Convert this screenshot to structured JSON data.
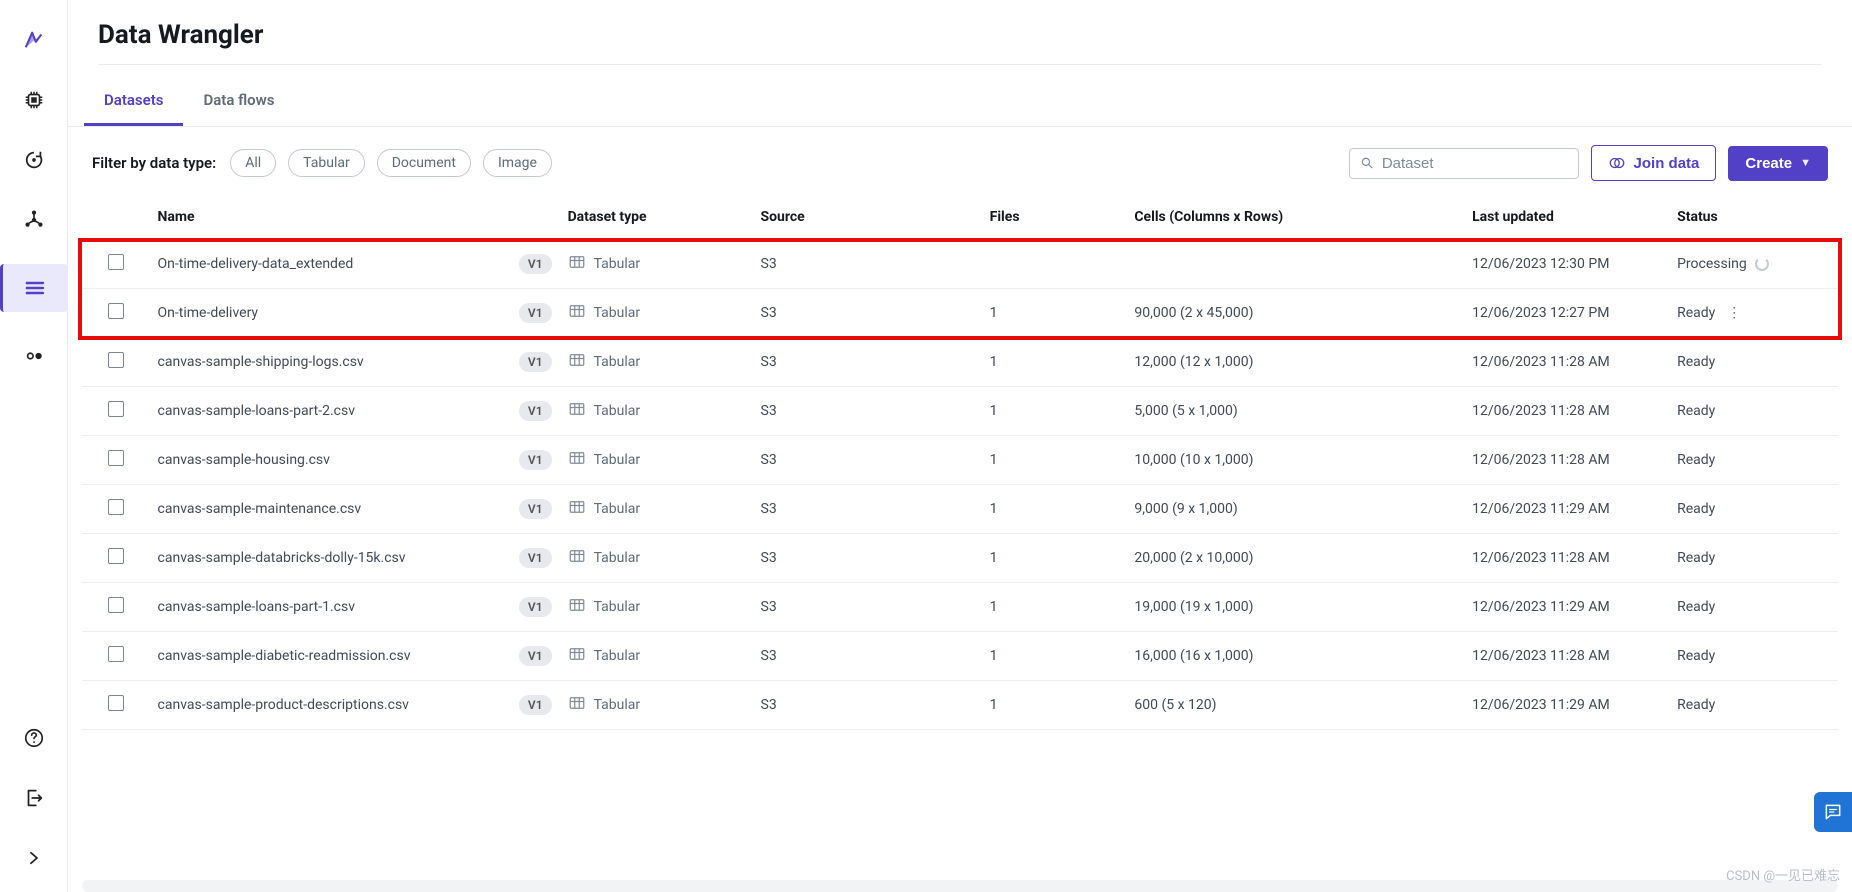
{
  "page_title": "Data Wrangler",
  "tabs": {
    "datasets": "Datasets",
    "dataflows": "Data flows"
  },
  "filter": {
    "label": "Filter by data type:",
    "chips": [
      "All",
      "Tabular",
      "Document",
      "Image"
    ]
  },
  "search": {
    "placeholder": "Dataset"
  },
  "buttons": {
    "join": "Join data",
    "create": "Create"
  },
  "columns": {
    "name": "Name",
    "type": "Dataset type",
    "source": "Source",
    "files": "Files",
    "cells": "Cells (Columns x Rows)",
    "updated": "Last updated",
    "status": "Status"
  },
  "type_label": "Tabular",
  "rows": [
    {
      "name": "On-time-delivery-data_extended",
      "version": "V1",
      "source": "S3",
      "files": "",
      "cells": "",
      "updated": "12/06/2023 12:30 PM",
      "status": "Processing",
      "processing": true,
      "highlight": true
    },
    {
      "name": "On-time-delivery",
      "version": "V1",
      "source": "S3",
      "files": "1",
      "cells": "90,000 (2 x 45,000)",
      "updated": "12/06/2023 12:27 PM",
      "status": "Ready",
      "highlight": true,
      "show_more": true
    },
    {
      "name": "canvas-sample-shipping-logs.csv",
      "version": "V1",
      "source": "S3",
      "files": "1",
      "cells": "12,000 (12 x 1,000)",
      "updated": "12/06/2023 11:28 AM",
      "status": "Ready"
    },
    {
      "name": "canvas-sample-loans-part-2.csv",
      "version": "V1",
      "source": "S3",
      "files": "1",
      "cells": "5,000 (5 x 1,000)",
      "updated": "12/06/2023 11:28 AM",
      "status": "Ready"
    },
    {
      "name": "canvas-sample-housing.csv",
      "version": "V1",
      "source": "S3",
      "files": "1",
      "cells": "10,000 (10 x 1,000)",
      "updated": "12/06/2023 11:28 AM",
      "status": "Ready"
    },
    {
      "name": "canvas-sample-maintenance.csv",
      "version": "V1",
      "source": "S3",
      "files": "1",
      "cells": "9,000 (9 x 1,000)",
      "updated": "12/06/2023 11:29 AM",
      "status": "Ready"
    },
    {
      "name": "canvas-sample-databricks-dolly-15k.csv",
      "version": "V1",
      "source": "S3",
      "files": "1",
      "cells": "20,000 (2 x 10,000)",
      "updated": "12/06/2023 11:28 AM",
      "status": "Ready"
    },
    {
      "name": "canvas-sample-loans-part-1.csv",
      "version": "V1",
      "source": "S3",
      "files": "1",
      "cells": "19,000 (19 x 1,000)",
      "updated": "12/06/2023 11:29 AM",
      "status": "Ready"
    },
    {
      "name": "canvas-sample-diabetic-readmission.csv",
      "version": "V1",
      "source": "S3",
      "files": "1",
      "cells": "16,000 (16 x 1,000)",
      "updated": "12/06/2023 11:28 AM",
      "status": "Ready"
    },
    {
      "name": "canvas-sample-product-descriptions.csv",
      "version": "V1",
      "source": "S3",
      "files": "1",
      "cells": "600 (5 x 120)",
      "updated": "12/06/2023 11:29 AM",
      "status": "Ready"
    }
  ],
  "watermark": "CSDN @一见已难忘"
}
